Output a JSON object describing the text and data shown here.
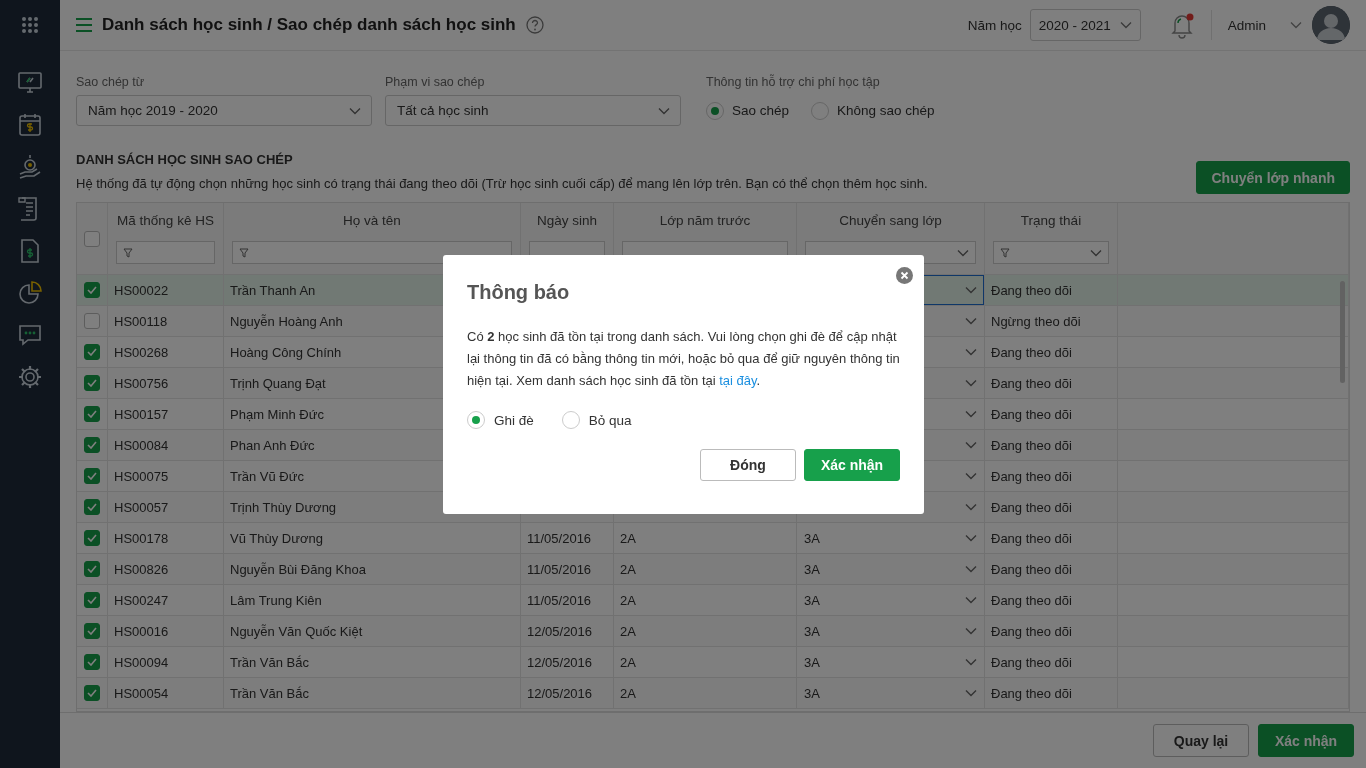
{
  "header": {
    "title": "Danh sách học sinh / Sao chép danh sách học sinh",
    "school_year_label": "Năm học",
    "school_year": "2020 - 2021",
    "notification_unread": true,
    "user": "Admin"
  },
  "filters": {
    "copy_from": {
      "label": "Sao chép từ",
      "value": "Năm học 2019 - 2020"
    },
    "scope": {
      "label": "Phạm vi sao chép",
      "value": "Tất cả học sinh"
    },
    "support_info": {
      "label": "Thông tin hỗ trợ chi phí học tập",
      "options": [
        {
          "label": "Sao chép",
          "selected": true
        },
        {
          "label": "Không sao chép",
          "selected": false
        }
      ]
    }
  },
  "section": {
    "title": "DANH SÁCH HỌC SINH SAO CHÉP",
    "description": "Hệ thống đã tự động chọn những học sinh có trạng thái đang theo dõi (Trừ học sinh cuối cấp) để mang lên lớp trên. Bạn có thể chọn thêm học sinh.",
    "quick_transfer_button": "Chuyển lớp nhanh"
  },
  "table": {
    "all_checked": false,
    "columns": [
      {
        "label": "Mã thống kê HS",
        "funnel": true,
        "dropdown": false
      },
      {
        "label": "Họ và tên",
        "funnel": true,
        "dropdown": false
      },
      {
        "label": "Ngày sinh",
        "funnel": false,
        "dropdown": false
      },
      {
        "label": "Lớp năm trước",
        "funnel": false,
        "dropdown": false
      },
      {
        "label": "Chuyển sang lớp",
        "funnel": false,
        "dropdown": true
      },
      {
        "label": "Trạng thái",
        "funnel": true,
        "dropdown": true
      }
    ],
    "rows": [
      {
        "checked": true,
        "selected": true,
        "code": "HS00022",
        "name": "Trần Thanh An",
        "status": "Đang theo dõi"
      },
      {
        "checked": false,
        "selected": false,
        "code": "HS00118",
        "name": "Nguyễn Hoàng Anh",
        "status": "Ngừng theo dõi"
      },
      {
        "checked": true,
        "selected": false,
        "code": "HS00268",
        "name": "Hoàng Công Chính",
        "status": "Đang theo dõi"
      },
      {
        "checked": true,
        "selected": false,
        "code": "HS00756",
        "name": "Trịnh Quang Đạt",
        "status": "Đang theo dõi"
      },
      {
        "checked": true,
        "selected": false,
        "code": "HS00157",
        "name": "Phạm Minh Đức",
        "status": "Đang theo dõi"
      },
      {
        "checked": true,
        "selected": false,
        "code": "HS00084",
        "name": "Phan Anh Đức",
        "status": "Đang theo dõi"
      },
      {
        "checked": true,
        "selected": false,
        "code": "HS00075",
        "name": "Trần Vũ Đức",
        "status": "Đang theo dõi"
      },
      {
        "checked": true,
        "selected": false,
        "code": "HS00057",
        "name": "Trịnh Thùy Dương",
        "status": "Đang theo dõi"
      },
      {
        "checked": true,
        "selected": false,
        "code": "HS00178",
        "name": "Vũ Thùy Dương",
        "birth_date": "11/05/2016",
        "previous_class": "2A",
        "next_class": "3A",
        "status": "Đang theo dõi"
      },
      {
        "checked": true,
        "selected": false,
        "code": "HS00826",
        "name": "Nguyễn Bùi Đăng Khoa",
        "birth_date": "11/05/2016",
        "previous_class": "2A",
        "next_class": "3A",
        "status": "Đang theo dõi"
      },
      {
        "checked": true,
        "selected": false,
        "code": "HS00247",
        "name": "Lâm Trung Kiên",
        "birth_date": "11/05/2016",
        "previous_class": "2A",
        "next_class": "3A",
        "status": "Đang theo dõi"
      },
      {
        "checked": true,
        "selected": false,
        "code": "HS00016",
        "name": "Nguyễn Văn Quốc Kiệt",
        "birth_date": "12/05/2016",
        "previous_class": "2A",
        "next_class": "3A",
        "status": "Đang theo dõi"
      },
      {
        "checked": true,
        "selected": false,
        "code": "HS00094",
        "name": "Trần Văn Bắc",
        "birth_date": "12/05/2016",
        "previous_class": "2A",
        "next_class": "3A",
        "status": "Đang theo dõi"
      },
      {
        "checked": true,
        "selected": false,
        "code": "HS00054",
        "name": "Trần Văn Bắc",
        "birth_date": "12/05/2016",
        "previous_class": "2A",
        "next_class": "3A",
        "status": "Đang theo dõi"
      }
    ]
  },
  "footer": {
    "buttons": [
      {
        "label": "Quay lại",
        "kind": "secondary"
      },
      {
        "label": "Xác nhận",
        "kind": "primary"
      }
    ]
  },
  "dialog": {
    "title": "Thông báo",
    "message": "Có **2** học sinh đã tồn tại trong danh sách. Vui lòng chọn ghi đè để cập nhật lại thông tin đã có bằng thông tin mới, hoặc bỏ qua để giữ nguyên thông tin hiện tại. Xem danh sách học sinh đã tồn tại ",
    "link": "tại đây",
    "message_end": ".",
    "options": [
      {
        "label": "Ghi đè",
        "selected": true
      },
      {
        "label": "Bỏ qua",
        "selected": false
      }
    ],
    "buttons": [
      {
        "label": "Đóng",
        "kind": "secondary"
      },
      {
        "label": "Xác nhận",
        "kind": "primary"
      }
    ]
  }
}
